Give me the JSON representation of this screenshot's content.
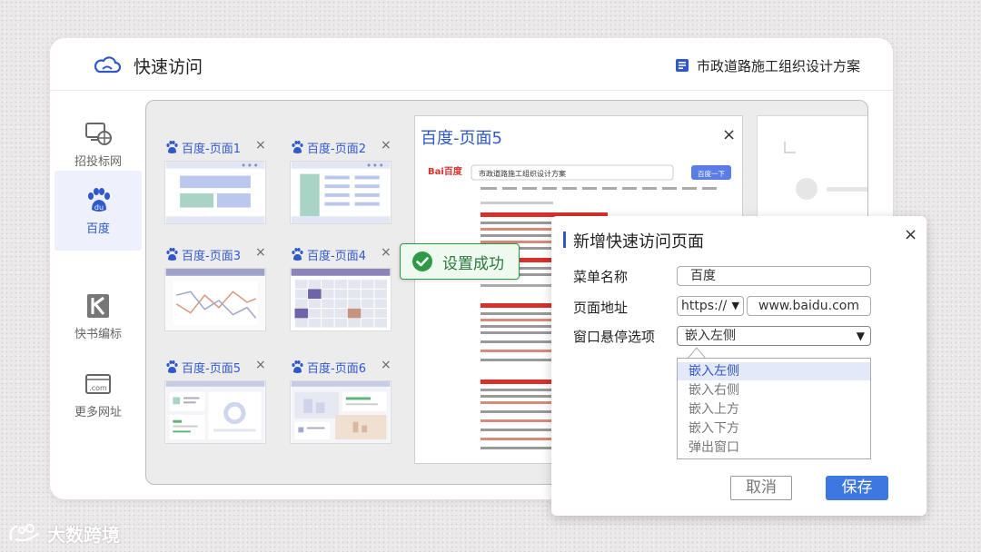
{
  "app": {
    "title": "快速访问",
    "document_title": "市政道路施工组织设计方案"
  },
  "sidebar": {
    "items": [
      {
        "label": "招投标网",
        "active": false
      },
      {
        "label": "百度",
        "active": true
      },
      {
        "label": "快书编标",
        "active": false
      },
      {
        "label": "更多网址",
        "active": false
      }
    ],
    "more_site_icon_text": ".com"
  },
  "thumbnails": [
    {
      "label": "百度-页面1"
    },
    {
      "label": "百度-页面2"
    },
    {
      "label": "百度-页面3"
    },
    {
      "label": "百度-页面4"
    },
    {
      "label": "百度-页面5"
    },
    {
      "label": "百度-页面6"
    }
  ],
  "thumbnail_close": "×",
  "browser": {
    "title": "百度-页面5",
    "close": "×",
    "search_query": "市政道路施工组织设计方案",
    "search_button": "百度一下",
    "logo": "Bai百度"
  },
  "toast": {
    "text": "设置成功"
  },
  "dialog": {
    "title": "新增快速访问页面",
    "close": "×",
    "menu_name_label": "菜单名称",
    "menu_name_value": "百度",
    "url_label": "页面地址",
    "protocol_value": "https://",
    "url_value": "www.baidu.com",
    "float_label": "窗口悬停选项",
    "float_value": "嵌入左侧",
    "float_options": [
      "嵌入左侧",
      "嵌入右侧",
      "嵌入上方",
      "嵌入下方",
      "弹出窗口"
    ],
    "cancel_label": "取消",
    "save_label": "保存"
  },
  "brand": {
    "text": "大数跨境"
  },
  "colors": {
    "accent": "#2f58cd",
    "save_button": "#3f77e0",
    "success": "#2f9a46",
    "link_red": "#d9302a"
  }
}
